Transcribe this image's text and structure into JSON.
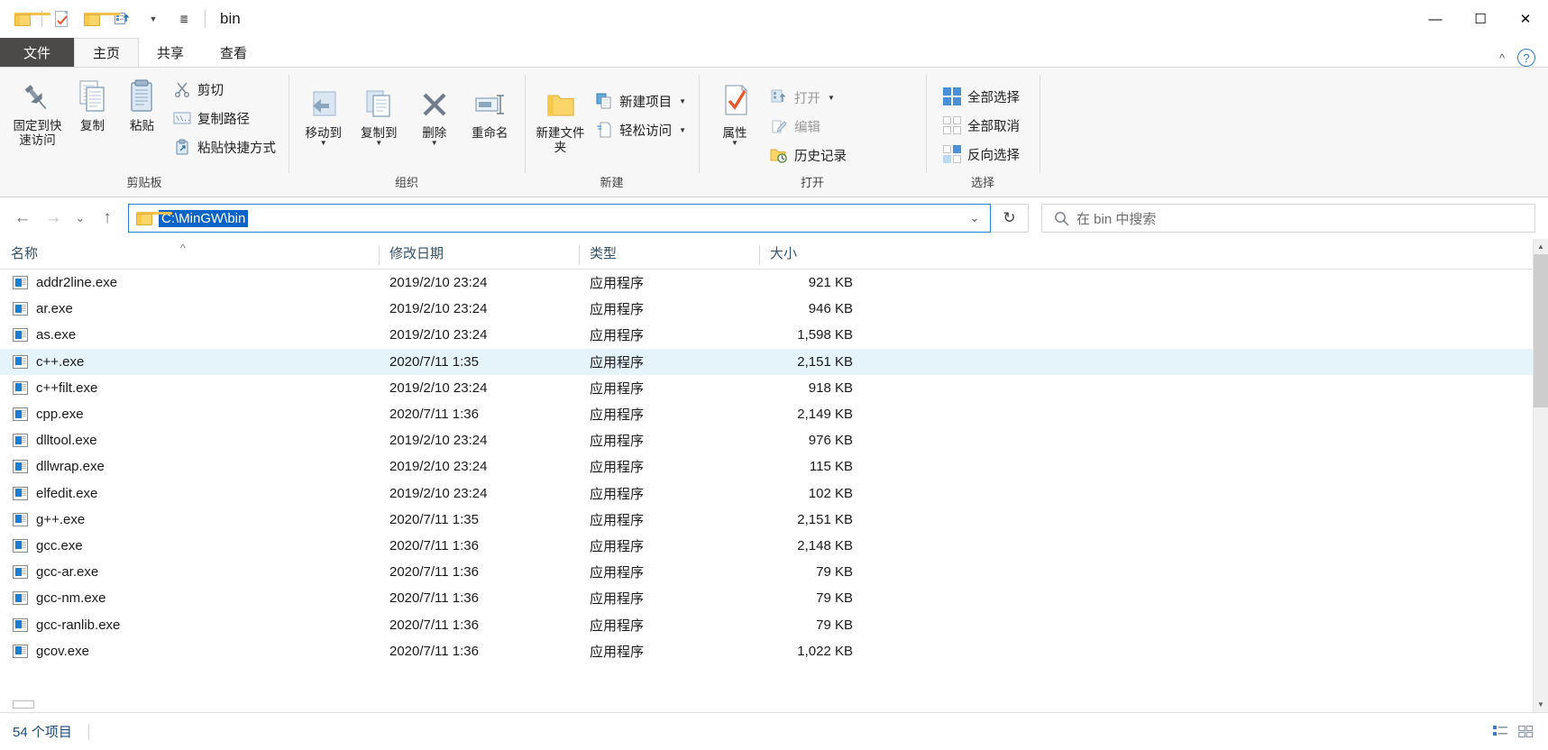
{
  "window": {
    "title": "bin",
    "quick_access": [
      "folder-icon",
      "checkmark-doc-icon",
      "folder-icon",
      "customize-icon"
    ],
    "controls": {
      "minimize": "—",
      "maximize": "☐",
      "close": "✕"
    }
  },
  "ribbon": {
    "tabs": [
      {
        "label": "文件",
        "id": "file"
      },
      {
        "label": "主页",
        "id": "home",
        "active": true
      },
      {
        "label": "共享",
        "id": "share"
      },
      {
        "label": "查看",
        "id": "view"
      }
    ],
    "collapse_icon": "chevron-up-icon",
    "help_icon": "?",
    "groups": [
      {
        "name": "clipboard",
        "label": "剪贴板",
        "big": [
          {
            "label": "固定到快速访问",
            "icon": "pin-icon"
          },
          {
            "label": "复制",
            "icon": "copy-icon"
          },
          {
            "label": "粘贴",
            "icon": "paste-icon"
          }
        ],
        "small": [
          {
            "label": "剪切",
            "icon": "scissors-icon"
          },
          {
            "label": "复制路径",
            "icon": "copy-path-icon"
          },
          {
            "label": "粘贴快捷方式",
            "icon": "paste-shortcut-icon"
          }
        ]
      },
      {
        "name": "organize",
        "label": "组织",
        "big": [
          {
            "label": "移动到",
            "icon": "move-to-icon",
            "caret": true
          },
          {
            "label": "复制到",
            "icon": "copy-to-icon",
            "caret": true
          },
          {
            "label": "删除",
            "icon": "delete-icon",
            "caret": true
          },
          {
            "label": "重命名",
            "icon": "rename-icon"
          }
        ],
        "small": []
      },
      {
        "name": "new",
        "label": "新建",
        "big": [
          {
            "label": "新建文件夹",
            "icon": "new-folder-icon"
          }
        ],
        "small": [
          {
            "label": "新建项目",
            "icon": "new-item-icon",
            "caret": true
          },
          {
            "label": "轻松访问",
            "icon": "easy-access-icon",
            "caret": true
          }
        ]
      },
      {
        "name": "open",
        "label": "打开",
        "big": [
          {
            "label": "属性",
            "icon": "properties-icon",
            "caret": true
          }
        ],
        "small": [
          {
            "label": "打开",
            "icon": "open-icon",
            "caret": true,
            "dim": true
          },
          {
            "label": "编辑",
            "icon": "edit-icon",
            "dim": true
          },
          {
            "label": "历史记录",
            "icon": "history-icon"
          }
        ]
      },
      {
        "name": "select",
        "label": "选择",
        "big": [],
        "small": [
          {
            "label": "全部选择",
            "icon": "select-all-icon"
          },
          {
            "label": "全部取消",
            "icon": "select-none-icon"
          },
          {
            "label": "反向选择",
            "icon": "invert-selection-icon"
          }
        ]
      }
    ]
  },
  "navigation": {
    "back_icon": "←",
    "forward_icon": "→",
    "recent_icon": "⌄",
    "up_icon": "↑",
    "address": {
      "value": "C:\\MinGW\\bin",
      "dropdown_icon": "⌄",
      "folder_icon": "folder-icon"
    },
    "refresh_icon": "↻",
    "search": {
      "placeholder": "在 bin 中搜索",
      "icon": "search-icon"
    }
  },
  "columns": [
    {
      "key": "name",
      "label": "名称",
      "sort": "asc"
    },
    {
      "key": "date",
      "label": "修改日期"
    },
    {
      "key": "type",
      "label": "类型"
    },
    {
      "key": "size",
      "label": "大小"
    }
  ],
  "files": [
    {
      "name": "addr2line.exe",
      "date": "2019/2/10 23:24",
      "type": "应用程序",
      "size": "921 KB",
      "hover": false
    },
    {
      "name": "ar.exe",
      "date": "2019/2/10 23:24",
      "type": "应用程序",
      "size": "946 KB",
      "hover": false
    },
    {
      "name": "as.exe",
      "date": "2019/2/10 23:24",
      "type": "应用程序",
      "size": "1,598 KB",
      "hover": false
    },
    {
      "name": "c++.exe",
      "date": "2020/7/11 1:35",
      "type": "应用程序",
      "size": "2,151 KB",
      "hover": true
    },
    {
      "name": "c++filt.exe",
      "date": "2019/2/10 23:24",
      "type": "应用程序",
      "size": "918 KB",
      "hover": false
    },
    {
      "name": "cpp.exe",
      "date": "2020/7/11 1:36",
      "type": "应用程序",
      "size": "2,149 KB",
      "hover": false
    },
    {
      "name": "dlltool.exe",
      "date": "2019/2/10 23:24",
      "type": "应用程序",
      "size": "976 KB",
      "hover": false
    },
    {
      "name": "dllwrap.exe",
      "date": "2019/2/10 23:24",
      "type": "应用程序",
      "size": "115 KB",
      "hover": false
    },
    {
      "name": "elfedit.exe",
      "date": "2019/2/10 23:24",
      "type": "应用程序",
      "size": "102 KB",
      "hover": false
    },
    {
      "name": "g++.exe",
      "date": "2020/7/11 1:35",
      "type": "应用程序",
      "size": "2,151 KB",
      "hover": false
    },
    {
      "name": "gcc.exe",
      "date": "2020/7/11 1:36",
      "type": "应用程序",
      "size": "2,148 KB",
      "hover": false
    },
    {
      "name": "gcc-ar.exe",
      "date": "2020/7/11 1:36",
      "type": "应用程序",
      "size": "79 KB",
      "hover": false
    },
    {
      "name": "gcc-nm.exe",
      "date": "2020/7/11 1:36",
      "type": "应用程序",
      "size": "79 KB",
      "hover": false
    },
    {
      "name": "gcc-ranlib.exe",
      "date": "2020/7/11 1:36",
      "type": "应用程序",
      "size": "79 KB",
      "hover": false
    },
    {
      "name": "gcov.exe",
      "date": "2020/7/11 1:36",
      "type": "应用程序",
      "size": "1,022 KB",
      "hover": false
    }
  ],
  "status": {
    "item_count": "54 个项目",
    "view_details_icon": "details-view-icon",
    "view_tiles_icon": "tiles-view-icon"
  }
}
